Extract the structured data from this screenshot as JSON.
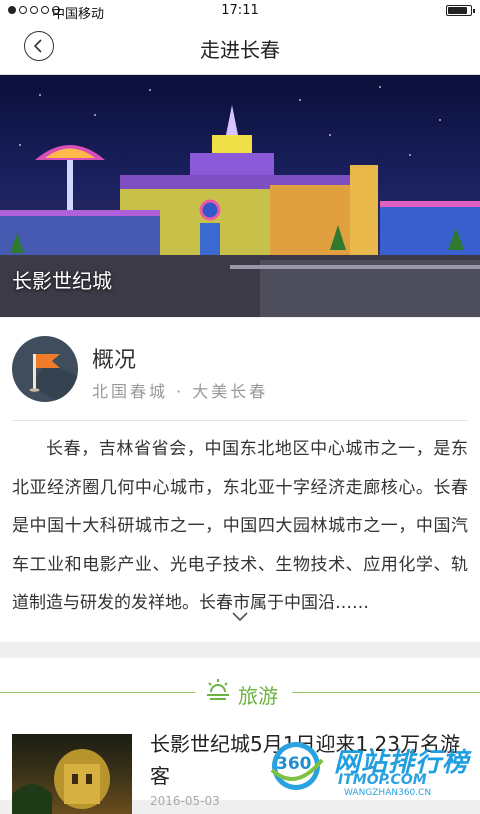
{
  "status_bar": {
    "carrier": "中国移动",
    "time": "17:11"
  },
  "header": {
    "title": "走进长春"
  },
  "banner": {
    "caption": "长影世纪城",
    "slide_count": 3,
    "active_slide": 1
  },
  "overview": {
    "title": "概况",
    "subtitle": "北国春城 · 大美长春",
    "text": "长春，吉林省省会，中国东北地区中心城市之一，是东北亚经济圈几何中心城市，东北亚十字经济走廊核心。长春是中国十大科研城市之一，中国四大园林城市之一，中国汽车工业和电影产业、光电子技术、生物技术、应用化学、轨道制造与研发的发祥地。长春市属于中国沿……"
  },
  "travel": {
    "section_label": "旅游",
    "articles": [
      {
        "title": "长影世纪城5月1日迎来1.23万名游客",
        "date": "2016-05-03"
      }
    ]
  },
  "watermark": {
    "logo": "360",
    "brand": "网站排行榜",
    "sub": "ITMOP.COM",
    "url": "WANGZHAN360.CN"
  },
  "colors": {
    "accent": "#6cb33f",
    "avatar_bg": "#3f4d5c",
    "flag": "#f07c2a"
  }
}
